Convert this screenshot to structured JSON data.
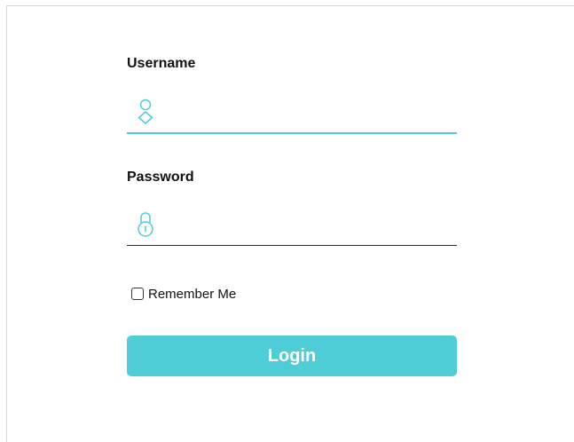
{
  "form": {
    "username": {
      "label": "Username",
      "value": "",
      "placeholder": "",
      "icon": "user-icon",
      "underline_color": "#4ecdd6"
    },
    "password": {
      "label": "Password",
      "value": "",
      "placeholder": "",
      "icon": "lock-icon",
      "underline_color": "#333333"
    },
    "remember": {
      "label": "Remember Me",
      "checked": false
    },
    "login": {
      "label": "Login",
      "background": "#4ecdd6",
      "text_color": "#ffffff"
    }
  },
  "colors": {
    "accent": "#4ecdd6",
    "icon": "#4ecdd6"
  }
}
